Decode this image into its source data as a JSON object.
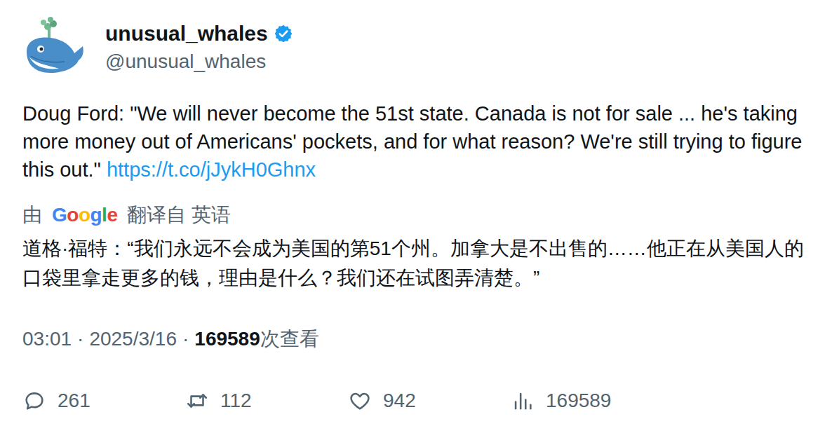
{
  "author": {
    "name": "unusual_whales",
    "handle": "@unusual_whales",
    "verified": true
  },
  "tweet": {
    "text": "Doug Ford: \"We will never become the 51st state. Canada is not for sale ... he's taking more money out of Americans' pockets, and for what reason? We're still trying to figure this out.\"",
    "link": "https://t.co/jJykH0Ghnx"
  },
  "translation": {
    "prefix": "由",
    "provider": [
      {
        "letter": "G",
        "color": "#4285F4"
      },
      {
        "letter": "o",
        "color": "#EA4335"
      },
      {
        "letter": "o",
        "color": "#FBBC05"
      },
      {
        "letter": "g",
        "color": "#4285F4"
      },
      {
        "letter": "l",
        "color": "#34A853"
      },
      {
        "letter": "e",
        "color": "#EA4335"
      }
    ],
    "suffix": "翻译自 英语",
    "text": "道格·福特：“我们永远不会成为美国的第51个州。加拿大是不出售的……他正在从美国人的口袋里拿走更多的钱，理由是什么？我们还在试图弄清楚。”"
  },
  "meta": {
    "time": "03:01",
    "separator": "·",
    "date": "2025/3/16",
    "views": "169589",
    "views_label": "次查看"
  },
  "actions": [
    {
      "kind": "reply",
      "count": "261"
    },
    {
      "kind": "retweet",
      "count": "112"
    },
    {
      "kind": "like",
      "count": "942"
    },
    {
      "kind": "views",
      "count": "169589"
    }
  ]
}
